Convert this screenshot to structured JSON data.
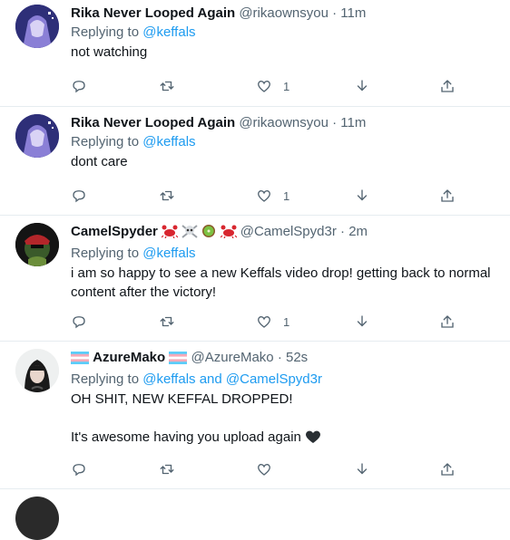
{
  "tweets": [
    {
      "name": "Rika Never Looped Again",
      "handle": "@rikaownsyou",
      "time": "11m",
      "reply_prefix": "Replying to ",
      "reply_to": "@keffals",
      "text": "not watching",
      "likes": "1"
    },
    {
      "name": "Rika Never Looped Again",
      "handle": "@rikaownsyou",
      "time": "11m",
      "reply_prefix": "Replying to ",
      "reply_to": "@keffals",
      "text": "dont care",
      "likes": "1"
    },
    {
      "name": "CamelSpyder",
      "handle": "@CamelSpyd3r",
      "time": "2m",
      "reply_prefix": "Replying to ",
      "reply_to": "@keffals",
      "text": "i am so happy to see a new Keffals video drop! getting back to normal content after the victory!",
      "likes": "1"
    },
    {
      "name": "AzureMako",
      "handle": "@AzureMako",
      "time": "52s",
      "reply_prefix": "Replying to ",
      "reply_to": "@keffals and @CamelSpyd3r",
      "text_line1": "OH SHIT, NEW KEFFAL DROPPED!",
      "text_line2": "It's awesome having you upload again",
      "likes": ""
    }
  ],
  "separator": "·",
  "icons": [
    "reply-icon",
    "retweet-icon",
    "like-icon",
    "share-down-icon",
    "upload-icon"
  ],
  "colors": {
    "link": "#1d9bf0",
    "muted": "#536471",
    "text": "#0f1419"
  }
}
